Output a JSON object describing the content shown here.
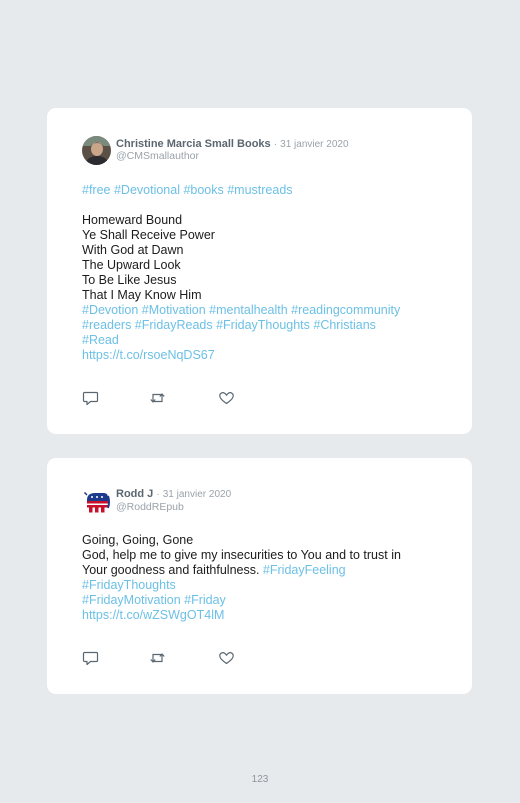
{
  "tweets": [
    {
      "author": "Christine Marcia Small Books",
      "separator": "·",
      "date": "31 janvier 2020",
      "handle": "@CMSmallauthor",
      "avatar_icon": "author-photo-avatar",
      "lines": [
        {
          "text": "#free #Devotional #books #mustreads",
          "style": "tag"
        },
        {
          "text": "",
          "style": "gap"
        },
        {
          "text": "Homeward Bound",
          "style": "text"
        },
        {
          "text": "Ye Shall Receive Power",
          "style": "text"
        },
        {
          "text": "With God at Dawn",
          "style": "text"
        },
        {
          "text": "The Upward Look",
          "style": "text"
        },
        {
          "text": "To Be Like Jesus",
          "style": "text"
        },
        {
          "text": "That I May Know Him",
          "style": "text"
        },
        {
          "text": "#Devotion #Motivation #mentalhealth #readingcommunity",
          "style": "tag"
        },
        {
          "text": "#readers #FridayReads #FridayThoughts #Christians",
          "style": "tag"
        },
        {
          "text": "#Read",
          "style": "tag"
        },
        {
          "text": "https://t.co/rsoeNqDS67",
          "style": "tag"
        }
      ]
    },
    {
      "author": "Rodd J",
      "separator": "·",
      "date": "31 janvier 2020",
      "handle": "@RoddREpub",
      "avatar_icon": "republican-elephant-avatar",
      "lines": [
        {
          "text": "Going, Going, Gone",
          "style": "text"
        },
        {
          "text": "God, help me to give my insecurities to You and to trust in",
          "style": "text"
        },
        {
          "text": "Your goodness and faithfulness. ",
          "style": "text",
          "tag_suffix": "#FridayFeeling"
        },
        {
          "text": "#FridayThoughts",
          "style": "tag"
        },
        {
          "text": "#FridayMotivation #Friday",
          "style": "tag"
        },
        {
          "text": "https://t.co/wZSWgOT4lM",
          "style": "tag"
        }
      ]
    }
  ],
  "actions": [
    "reply-icon",
    "retweet-icon",
    "like-icon"
  ],
  "colors": {
    "hashtag": "#6cc0e6",
    "background": "#e6eaed",
    "name": "#5b6770",
    "meta": "#9aa3aa"
  },
  "page_number": "123"
}
